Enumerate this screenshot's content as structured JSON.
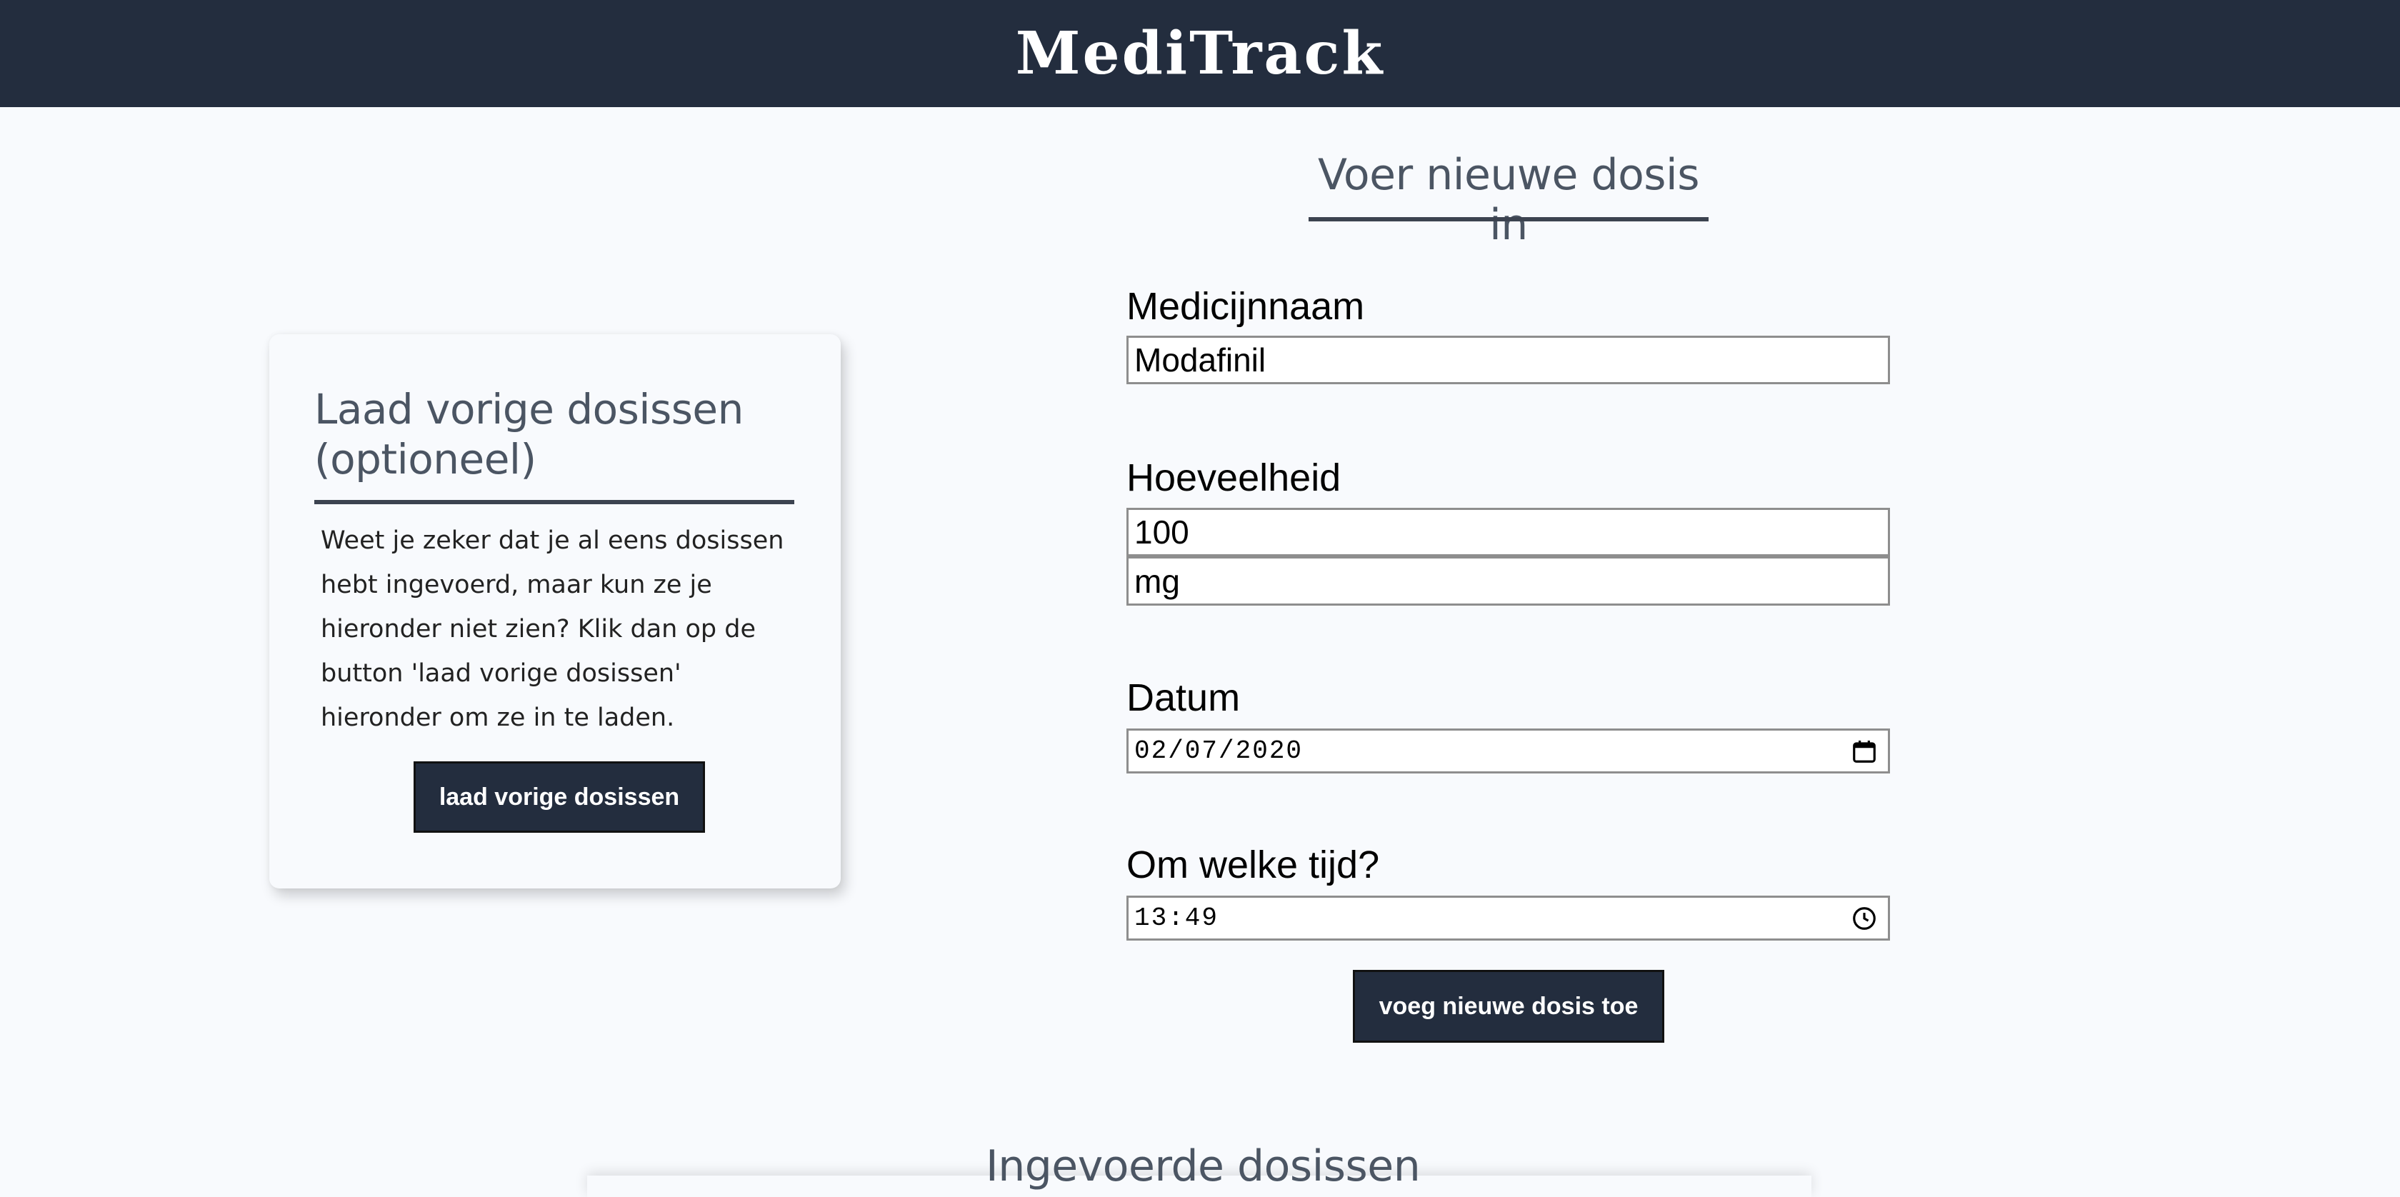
{
  "header": {
    "brand": "MediTrack"
  },
  "load_card": {
    "title": "Laad vorige dosissen (optioneel)",
    "text": "Weet je zeker dat je al eens dosissen hebt ingevoerd, maar kun ze je hieronder niet zien? Klik dan op de button 'laad vorige dosissen' hieronder om ze in te laden.",
    "button_label": "laad vorige dosissen"
  },
  "form": {
    "heading": "Voer nieuwe dosis in",
    "medicine_label": "Medicijnnaam",
    "medicine_value": "Modafinil",
    "amount_label": "Hoeveelheid",
    "amount_value": "100",
    "unit_value": "mg",
    "date_label": "Datum",
    "date_value": "02/07/2020",
    "time_label": "Om welke tijd?",
    "time_value": "13:49",
    "submit_label": "voeg nieuwe dosis toe",
    "calendar_icon": "calendar-icon",
    "clock_icon": "clock-icon"
  },
  "entries": {
    "heading": "Ingevoerde dosissen"
  },
  "colors": {
    "header_bg": "#232d3e",
    "button_bg": "#232d3e",
    "page_bg": "#f8fafd",
    "heading_text": "#4b5563"
  }
}
